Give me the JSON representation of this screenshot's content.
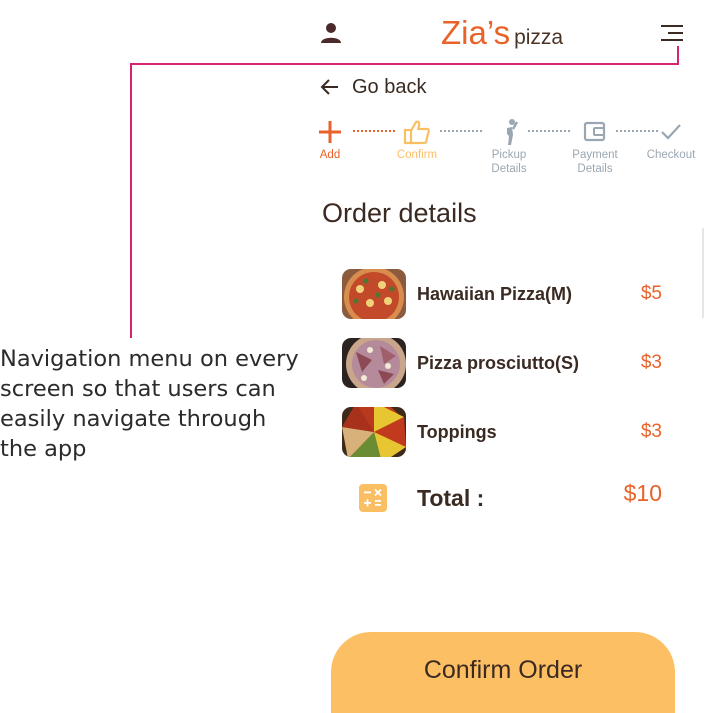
{
  "header": {
    "brand_main": "Zia’s",
    "brand_sub": "pizza",
    "user_icon": "user-icon",
    "menu_icon": "hamburger-menu-icon"
  },
  "nav": {
    "back_label": "Go back",
    "back_icon": "arrow-left-icon"
  },
  "stepper": {
    "steps": [
      {
        "label": "Add",
        "icon": "plus-icon",
        "color": "#e9622a"
      },
      {
        "label": "Confirm",
        "icon": "thumbs-up-icon",
        "color": "#fbbf63"
      },
      {
        "label": "Pickup\nDetails",
        "icon": "person-pickup-icon",
        "color": "#9aa7b2"
      },
      {
        "label": "Payment\nDetails",
        "icon": "wallet-icon",
        "color": "#9aa7b2"
      },
      {
        "label": "Checkout",
        "icon": "check-icon",
        "color": "#9aa7b2"
      }
    ]
  },
  "order": {
    "title": "Order details",
    "items": [
      {
        "name": "Hawaiian Pizza(M)",
        "price": "$5"
      },
      {
        "name": "Pizza prosciutto(S)",
        "price": "$3"
      },
      {
        "name": "Toppings",
        "price": "$3"
      }
    ],
    "total_label": "Total :",
    "total_value": "$10",
    "total_icon": "calculator-icon"
  },
  "actions": {
    "confirm_label": "Confirm Order"
  },
  "annotation": {
    "text": "Navigation menu on every screen so that users can easily navigate through the app"
  },
  "colors": {
    "accent": "#e9622a",
    "button": "#fcbf63",
    "annotation_line": "#d6246e",
    "text_dark": "#3a2a22",
    "inactive": "#9aa7b2"
  }
}
